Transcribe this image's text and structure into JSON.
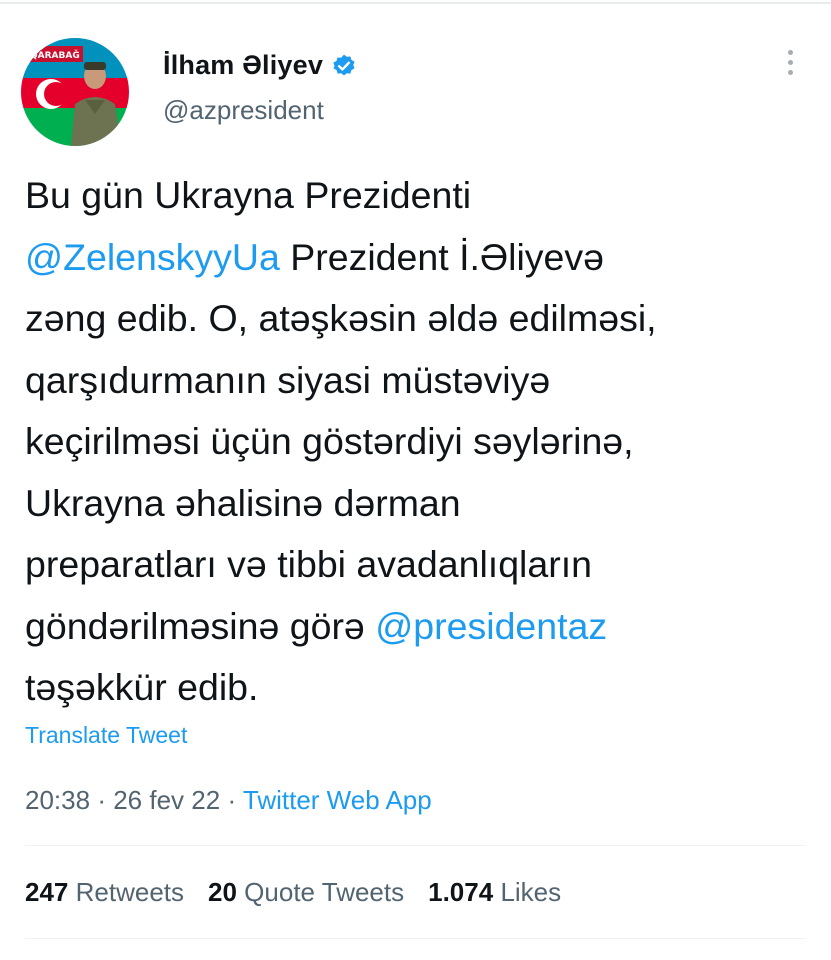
{
  "author": {
    "display_name": "İlham Əliyev",
    "handle": "@azpresident",
    "verified": true,
    "avatar_banner_text": "QARABAĞ"
  },
  "icons": {
    "verified": "verified-badge-icon",
    "more": "more-options-icon"
  },
  "tweet": {
    "segments": [
      {
        "text": "Bu gün Ukrayna Prezidenti\n",
        "type": "text"
      },
      {
        "text": "@ZelenskyyUa",
        "type": "mention"
      },
      {
        "text": " Prezident İ.Əliyevə\nzəng edib. O, atəşkəsin əldə edilməsi,\nqarşıdurmanın siyasi müstəviyə\nkeçirilməsi üçün göstərdiyi səylərinə,\nUkrayna əhalisinə dərman\npreparatları və tibbi avadanlıqların\ngöndərilməsinə görə ",
        "type": "text"
      },
      {
        "text": "@presidentaz",
        "type": "mention"
      },
      {
        "text": "\ntəşəkkür edib.",
        "type": "text"
      }
    ],
    "translate_label": "Translate Tweet",
    "time": "20:38",
    "date": "26 fev 22",
    "separator": "·",
    "source": "Twitter Web App"
  },
  "stats": {
    "retweets_count": "247",
    "retweets_label": "Retweets",
    "quotes_count": "20",
    "quotes_label": "Quote Tweets",
    "likes_count": "1.074",
    "likes_label": "Likes"
  },
  "colors": {
    "link": "#1d9bf0",
    "secondary_text": "#536471",
    "primary_text": "#0f1419",
    "flag_blue": "#0092bc",
    "flag_red": "#e4002b",
    "flag_green": "#00af50"
  }
}
